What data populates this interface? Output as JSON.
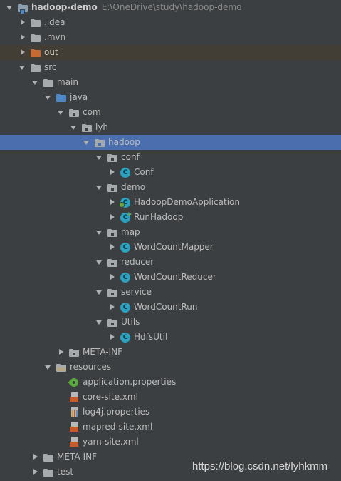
{
  "project_tree": {
    "root": {
      "name": "hadoop-demo",
      "path": "E:\\OneDrive\\study\\hadoop-demo"
    },
    "nodes": [
      {
        "label": "hadoop-demo",
        "icon": "module-folder-icon"
      },
      {
        "label": ".idea",
        "icon": "folder-icon"
      },
      {
        "label": ".mvn",
        "icon": "folder-icon"
      },
      {
        "label": "out",
        "icon": "excluded-folder-icon"
      },
      {
        "label": "src",
        "icon": "folder-icon"
      },
      {
        "label": "main",
        "icon": "folder-icon"
      },
      {
        "label": "java",
        "icon": "source-root-folder-icon"
      },
      {
        "label": "com",
        "icon": "package-icon"
      },
      {
        "label": "lyh",
        "icon": "package-icon"
      },
      {
        "label": "hadoop",
        "icon": "package-icon"
      },
      {
        "label": "conf",
        "icon": "package-icon"
      },
      {
        "label": "Conf",
        "icon": "class-icon"
      },
      {
        "label": "demo",
        "icon": "package-icon"
      },
      {
        "label": "HadoopDemoApplication",
        "icon": "spring-boot-class-icon"
      },
      {
        "label": "RunHadoop",
        "icon": "runnable-class-icon"
      },
      {
        "label": "map",
        "icon": "package-icon"
      },
      {
        "label": "WordCountMapper",
        "icon": "class-icon"
      },
      {
        "label": "reducer",
        "icon": "package-icon"
      },
      {
        "label": "WordCountReducer",
        "icon": "class-icon"
      },
      {
        "label": "service",
        "icon": "package-icon"
      },
      {
        "label": "WordCountRun",
        "icon": "class-icon"
      },
      {
        "label": "Utils",
        "icon": "package-icon"
      },
      {
        "label": "HdfsUtil",
        "icon": "class-icon"
      },
      {
        "label": "META-INF",
        "icon": "package-icon"
      },
      {
        "label": "resources",
        "icon": "resources-folder-icon"
      },
      {
        "label": "application.properties",
        "icon": "spring-properties-icon"
      },
      {
        "label": "core-site.xml",
        "icon": "xml-file-icon"
      },
      {
        "label": "log4j.properties",
        "icon": "properties-file-icon"
      },
      {
        "label": "mapred-site.xml",
        "icon": "xml-file-icon"
      },
      {
        "label": "yarn-site.xml",
        "icon": "xml-file-icon"
      },
      {
        "label": "META-INF",
        "icon": "folder-icon"
      },
      {
        "label": "test",
        "icon": "folder-icon"
      }
    ],
    "selected": "hadoop",
    "class_icon_letter": "C"
  },
  "watermark": "https://blog.csdn.net/lyhkmm",
  "colors": {
    "background": "#3c3f41",
    "selection": "#4b6eaf",
    "excluded_row": "#423e36",
    "class_icon": "#2aa2bf",
    "excluded_folder": "#c76a31",
    "source_folder": "#4a88c7"
  }
}
